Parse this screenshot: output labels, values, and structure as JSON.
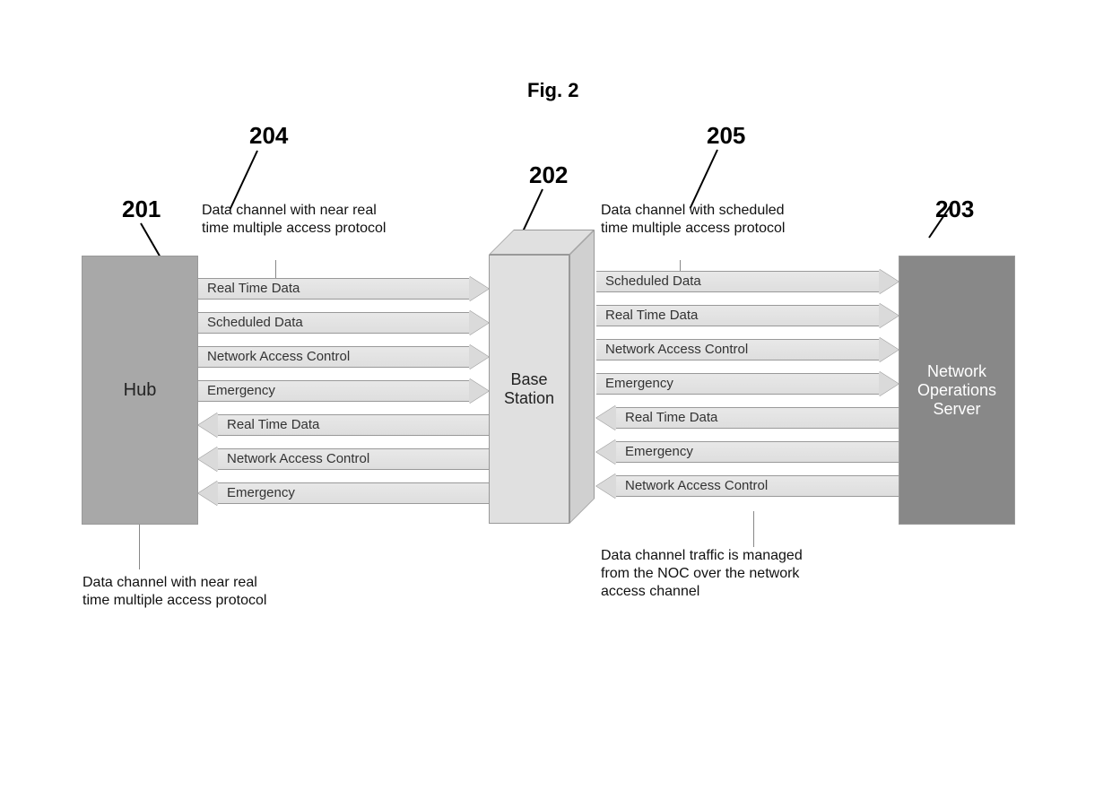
{
  "figure_title": "Fig. 2",
  "refs": {
    "r201": "201",
    "r202": "202",
    "r203": "203",
    "r204": "204",
    "r205": "205"
  },
  "boxes": {
    "hub": "Hub",
    "base_station": "Base\nStation",
    "nos": "Network\nOperations\nServer"
  },
  "annotations": {
    "a204": "Data channel with near real time multiple access protocol",
    "a205": "Data channel with scheduled time multiple access protocol",
    "a_hub_bottom": "Data channel with near real time multiple access protocol",
    "a_nos_bottom": "Data channel traffic is managed from the NOC over the network access channel"
  },
  "arrows_left": {
    "right": [
      "Real Time Data",
      "Scheduled Data",
      "Network Access Control",
      "Emergency"
    ],
    "left": [
      "Real Time Data",
      "Network Access Control",
      "Emergency"
    ]
  },
  "arrows_right": {
    "right": [
      "Scheduled Data",
      "Real Time Data",
      "Network Access Control",
      "Emergency"
    ],
    "left": [
      "Real Time Data",
      "Emergency",
      "Network Access Control"
    ]
  }
}
